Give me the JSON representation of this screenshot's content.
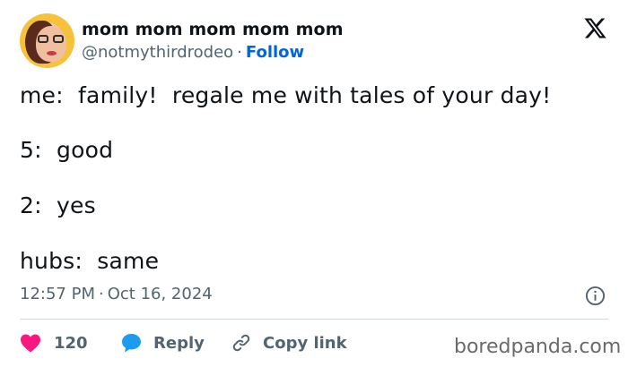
{
  "author": {
    "display_name": "mom mom mom mom mom",
    "handle": "@notmythirdrodeo",
    "separator": "·",
    "follow_label": "Follow"
  },
  "tweet": {
    "lines": [
      "me:  family!  regale me with tales of your day!",
      "5:  good",
      "2:  yes",
      "hubs:  same"
    ],
    "time": "12:57 PM",
    "separator": "·",
    "date": "Oct 16, 2024"
  },
  "actions": {
    "like_count": "120",
    "reply_label": "Reply",
    "copy_label": "Copy link"
  },
  "watermark": "boredpanda.com",
  "colors": {
    "like": "#f91880",
    "reply": "#1d9bf0",
    "follow": "#0066d9",
    "muted": "#536471"
  },
  "icons": [
    "x-logo-icon",
    "info-icon",
    "heart-icon",
    "speech-bubble-icon",
    "link-icon"
  ]
}
